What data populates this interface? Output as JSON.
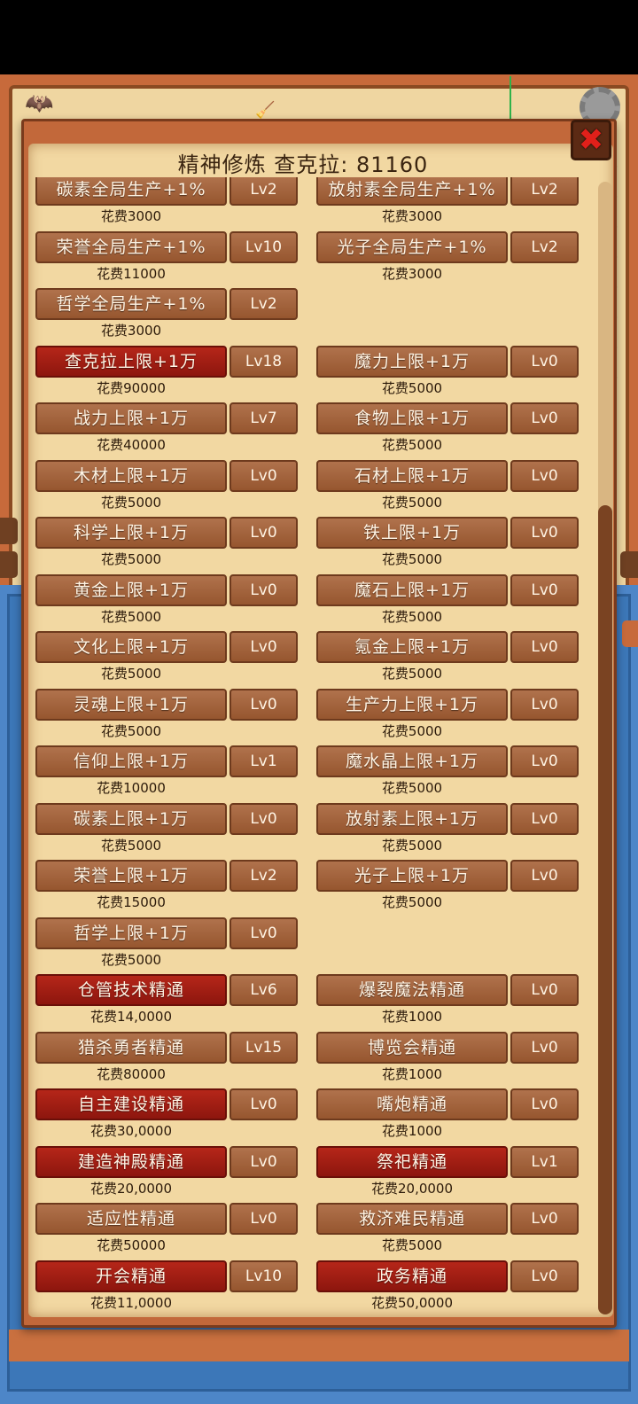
{
  "title": "精神修炼 查克拉: 81160",
  "close_icon": "close-x-icon",
  "rows": [
    {
      "left": {
        "name": "碳素全局生产+1%",
        "level": "Lv2",
        "cost": "花费3000",
        "red": false
      },
      "right": {
        "name": "放射素全局生产+1%",
        "level": "Lv2",
        "cost": "花费3000",
        "red": false
      }
    },
    {
      "left": {
        "name": "荣誉全局生产+1%",
        "level": "Lv10",
        "cost": "花费11000",
        "red": false
      },
      "right": {
        "name": "光子全局生产+1%",
        "level": "Lv2",
        "cost": "花费3000",
        "red": false
      }
    },
    {
      "left": {
        "name": "哲学全局生产+1%",
        "level": "Lv2",
        "cost": "花费3000",
        "red": false
      },
      "right": null
    },
    {
      "left": {
        "name": "查克拉上限+1万",
        "level": "Lv18",
        "cost": "花费90000",
        "red": true
      },
      "right": {
        "name": "魔力上限+1万",
        "level": "Lv0",
        "cost": "花费5000",
        "red": false
      }
    },
    {
      "left": {
        "name": "战力上限+1万",
        "level": "Lv7",
        "cost": "花费40000",
        "red": false
      },
      "right": {
        "name": "食物上限+1万",
        "level": "Lv0",
        "cost": "花费5000",
        "red": false
      }
    },
    {
      "left": {
        "name": "木材上限+1万",
        "level": "Lv0",
        "cost": "花费5000",
        "red": false
      },
      "right": {
        "name": "石材上限+1万",
        "level": "Lv0",
        "cost": "花费5000",
        "red": false
      }
    },
    {
      "left": {
        "name": "科学上限+1万",
        "level": "Lv0",
        "cost": "花费5000",
        "red": false
      },
      "right": {
        "name": "铁上限+1万",
        "level": "Lv0",
        "cost": "花费5000",
        "red": false
      }
    },
    {
      "left": {
        "name": "黄金上限+1万",
        "level": "Lv0",
        "cost": "花费5000",
        "red": false
      },
      "right": {
        "name": "魔石上限+1万",
        "level": "Lv0",
        "cost": "花费5000",
        "red": false
      }
    },
    {
      "left": {
        "name": "文化上限+1万",
        "level": "Lv0",
        "cost": "花费5000",
        "red": false
      },
      "right": {
        "name": "氪金上限+1万",
        "level": "Lv0",
        "cost": "花费5000",
        "red": false
      }
    },
    {
      "left": {
        "name": "灵魂上限+1万",
        "level": "Lv0",
        "cost": "花费5000",
        "red": false
      },
      "right": {
        "name": "生产力上限+1万",
        "level": "Lv0",
        "cost": "花费5000",
        "red": false
      }
    },
    {
      "left": {
        "name": "信仰上限+1万",
        "level": "Lv1",
        "cost": "花费10000",
        "red": false
      },
      "right": {
        "name": "魔水晶上限+1万",
        "level": "Lv0",
        "cost": "花费5000",
        "red": false
      }
    },
    {
      "left": {
        "name": "碳素上限+1万",
        "level": "Lv0",
        "cost": "花费5000",
        "red": false
      },
      "right": {
        "name": "放射素上限+1万",
        "level": "Lv0",
        "cost": "花费5000",
        "red": false
      }
    },
    {
      "left": {
        "name": "荣誉上限+1万",
        "level": "Lv2",
        "cost": "花费15000",
        "red": false
      },
      "right": {
        "name": "光子上限+1万",
        "level": "Lv0",
        "cost": "花费5000",
        "red": false
      }
    },
    {
      "left": {
        "name": "哲学上限+1万",
        "level": "Lv0",
        "cost": "花费5000",
        "red": false
      },
      "right": null
    },
    {
      "left": {
        "name": "仓管技术精通",
        "level": "Lv6",
        "cost": "花费14,0000",
        "red": true
      },
      "right": {
        "name": "爆裂魔法精通",
        "level": "Lv0",
        "cost": "花费1000",
        "red": false
      }
    },
    {
      "left": {
        "name": "猎杀勇者精通",
        "level": "Lv15",
        "cost": "花费80000",
        "red": false
      },
      "right": {
        "name": "博览会精通",
        "level": "Lv0",
        "cost": "花费1000",
        "red": false
      }
    },
    {
      "left": {
        "name": "自主建设精通",
        "level": "Lv0",
        "cost": "花费30,0000",
        "red": true
      },
      "right": {
        "name": "嘴炮精通",
        "level": "Lv0",
        "cost": "花费1000",
        "red": false
      }
    },
    {
      "left": {
        "name": "建造神殿精通",
        "level": "Lv0",
        "cost": "花费20,0000",
        "red": true
      },
      "right": {
        "name": "祭祀精通",
        "level": "Lv1",
        "cost": "花费20,0000",
        "red": true
      }
    },
    {
      "left": {
        "name": "适应性精通",
        "level": "Lv0",
        "cost": "花费50000",
        "red": false
      },
      "right": {
        "name": "救济难民精通",
        "level": "Lv0",
        "cost": "花费5000",
        "red": false
      }
    },
    {
      "left": {
        "name": "开会精通",
        "level": "Lv10",
        "cost": "花费11,0000",
        "red": true
      },
      "right": {
        "name": "政务精通",
        "level": "Lv0",
        "cost": "花费50,0000",
        "red": true
      }
    }
  ],
  "colors": {
    "panel": "#c2683a",
    "parchment": "#f2d8a2",
    "button_brown": "#a3643e",
    "button_red": "#a81e14",
    "text_dark": "#2c1a0a"
  }
}
